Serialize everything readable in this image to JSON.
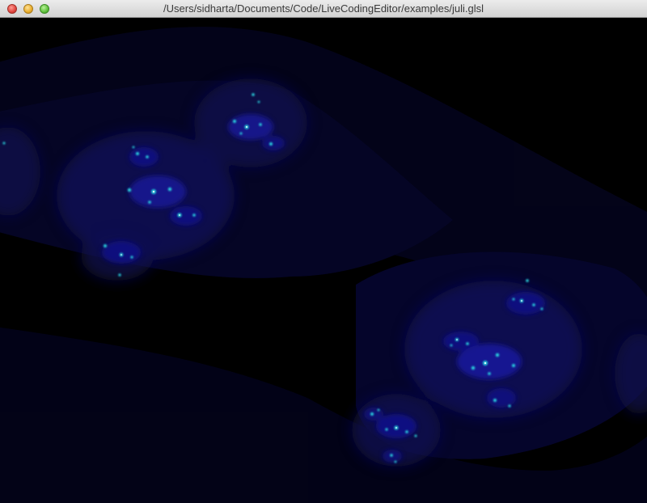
{
  "window": {
    "title": "/Users/sidharta/Documents/Code/LiveCodingEditor/examples/juli.glsl"
  },
  "render": {
    "background_color": "#000000",
    "glow_color": "#0a0a5a",
    "highlight_color": "#2ad6e0"
  }
}
